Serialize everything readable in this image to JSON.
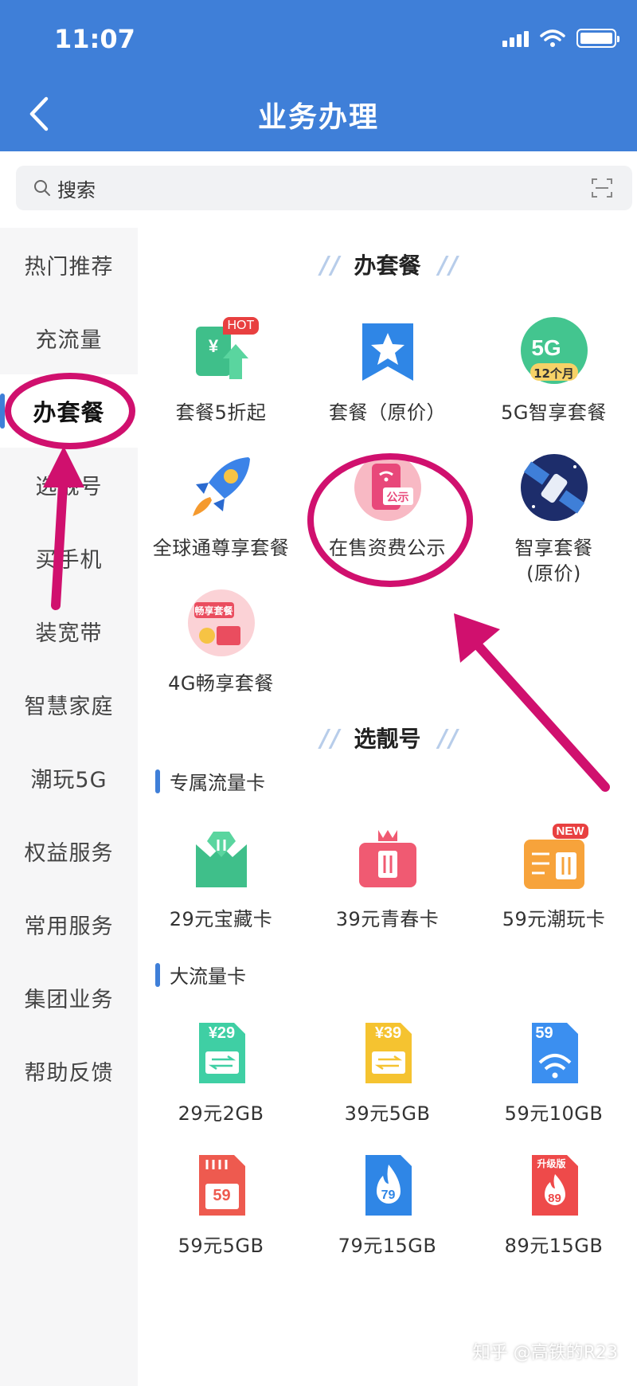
{
  "status": {
    "time": "11:07"
  },
  "header": {
    "title": "业务办理"
  },
  "search": {
    "placeholder": "搜索"
  },
  "sidebar": {
    "items": [
      {
        "label": "热门推荐"
      },
      {
        "label": "充流量"
      },
      {
        "label": "办套餐"
      },
      {
        "label": "选靓号"
      },
      {
        "label": "买手机"
      },
      {
        "label": "装宽带"
      },
      {
        "label": "智慧家庭"
      },
      {
        "label": "潮玩5G"
      },
      {
        "label": "权益服务"
      },
      {
        "label": "常用服务"
      },
      {
        "label": "集团业务"
      },
      {
        "label": "帮助反馈"
      }
    ],
    "active_index": 2
  },
  "sections": {
    "plans": {
      "title": "办套餐",
      "items": [
        {
          "label": "套餐5折起",
          "badge": "HOT",
          "icon": "hot-plan-icon"
        },
        {
          "label": "套餐（原价）",
          "icon": "star-bookmark-icon"
        },
        {
          "label": "5G智享套餐",
          "badge": "12个月",
          "icon": "5g-icon"
        },
        {
          "label": "全球通尊享套餐",
          "icon": "rocket-icon"
        },
        {
          "label": "在售资费公示",
          "badge": "公示",
          "icon": "tariff-notice-icon"
        },
        {
          "label": "智享套餐",
          "label2": "(原价)",
          "icon": "satellite-icon"
        },
        {
          "label": "4G畅享套餐",
          "badge": "畅享套餐",
          "icon": "4g-plan-icon"
        }
      ]
    },
    "numbers": {
      "title": "选靓号",
      "sub1": "专属流量卡",
      "sub1_items": [
        {
          "label": "29元宝藏卡",
          "icon": "treasure-card-icon"
        },
        {
          "label": "39元青春卡",
          "icon": "youth-card-icon"
        },
        {
          "label": "59元潮玩卡",
          "badge": "NEW",
          "icon": "trend-card-icon"
        }
      ],
      "sub2": "大流量卡",
      "sub2_items": [
        {
          "label": "29元2GB",
          "badge": "¥29",
          "icon": "sim-29-icon"
        },
        {
          "label": "39元5GB",
          "badge": "¥39",
          "icon": "sim-39-icon"
        },
        {
          "label": "59元10GB",
          "badge": "59",
          "icon": "sim-59-wifi-icon"
        },
        {
          "label": "59元5GB",
          "badge": "59",
          "icon": "sim-59-icon"
        },
        {
          "label": "79元15GB",
          "badge": "79",
          "icon": "sim-79-flame-icon"
        },
        {
          "label": "89元15GB",
          "badge": "89",
          "badge2": "升级版",
          "icon": "sim-89-upgrade-icon"
        }
      ]
    }
  },
  "watermark": "知乎 @高铁的R23",
  "colors": {
    "header": "#3f7fd8",
    "annotation": "#d0106e",
    "sidebar_bg": "#f6f6f7"
  }
}
